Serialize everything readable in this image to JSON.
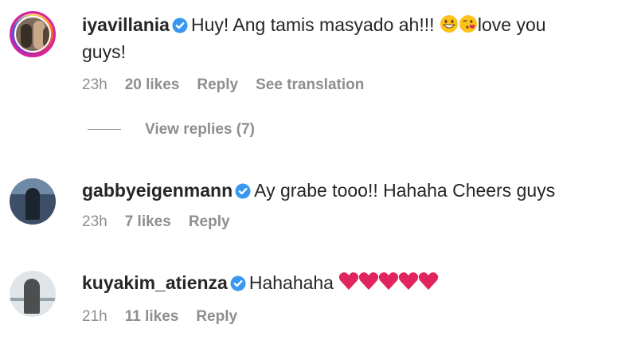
{
  "comments": [
    {
      "username": "iyavillania",
      "verified": true,
      "text": "Huy! Ang tamis masyado ah!!!",
      "emoji": [
        "grinning-face",
        "face-blowing-kiss"
      ],
      "text_after": "love you",
      "text_line2": "guys!",
      "time": "23h",
      "likes": "20 likes",
      "reply_label": "Reply",
      "translation_label": "See translation",
      "view_replies_label": "View replies (7)"
    },
    {
      "username": "gabbyeigenmann",
      "verified": true,
      "text": "Ay grabe tooo!! Hahaha Cheers guys",
      "time": "23h",
      "likes": "7 likes",
      "reply_label": "Reply"
    },
    {
      "username": "kuyakim_atienza",
      "verified": true,
      "text": "Hahahaha",
      "emoji": [
        "red-heart",
        "red-heart",
        "red-heart",
        "red-heart",
        "red-heart"
      ],
      "time": "21h",
      "likes": "11 likes",
      "reply_label": "Reply"
    }
  ],
  "colors": {
    "text": "#262626",
    "meta": "#8e8e8e",
    "verified": "#3897f0",
    "heart": "#e0245e"
  }
}
